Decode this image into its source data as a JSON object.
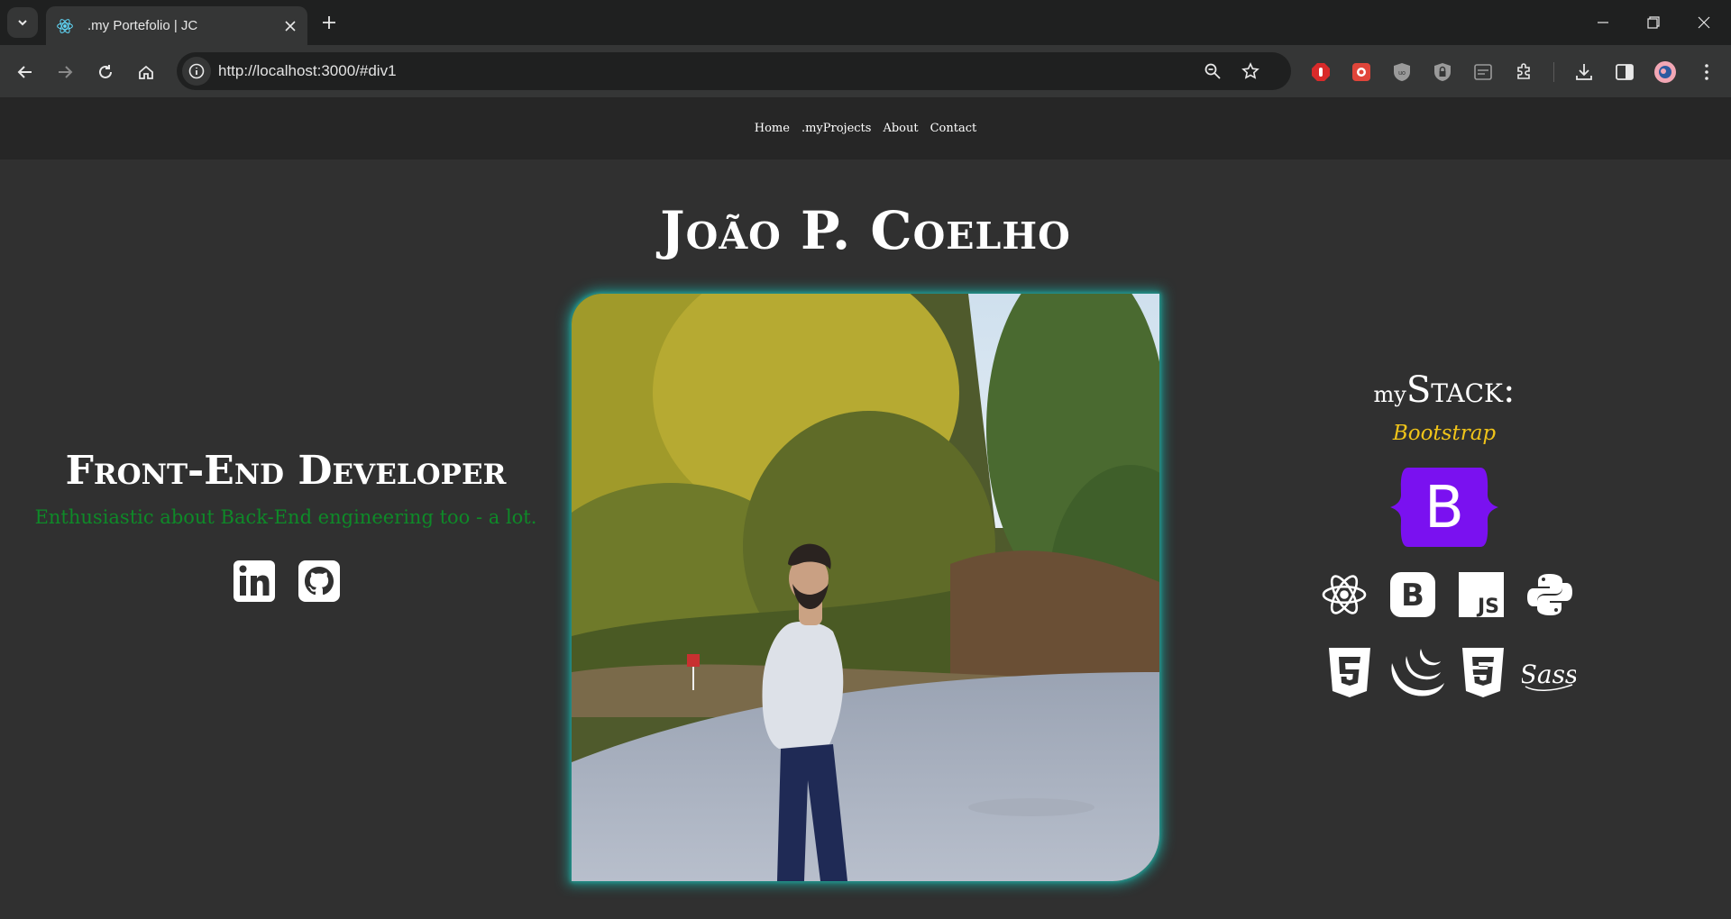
{
  "browser": {
    "tab_title": ".my Portefolio | JC",
    "url": "http://localhost:3000/#div1"
  },
  "nav": {
    "items": [
      "Home",
      ".myProjects",
      "About",
      "Contact"
    ]
  },
  "hero": {
    "name": "João P. Coelho",
    "role": "Front-End Developer",
    "tagline": "Enthusiastic about Back-End engineering too - a lot."
  },
  "stack": {
    "title_prefix": "my",
    "title_main": "Stack:",
    "current": "Bootstrap",
    "featured_letter": "B",
    "icons_row1": [
      "react-icon",
      "bootstrap-icon",
      "javascript-icon",
      "python-icon"
    ],
    "icons_row2": [
      "html5-icon",
      "jquery-icon",
      "css3-icon",
      "sass-icon"
    ],
    "bootstrap_badge_letter": "B",
    "js_badge_text": "JS",
    "sass_text": "Sass"
  },
  "colors": {
    "page_bg": "#303030",
    "nav_bg": "#262626",
    "tagline": "#0e8a28",
    "current_stack": "#f0c419",
    "bootstrap_purple": "#7a11f0",
    "photo_glow": "#1f8f88"
  }
}
